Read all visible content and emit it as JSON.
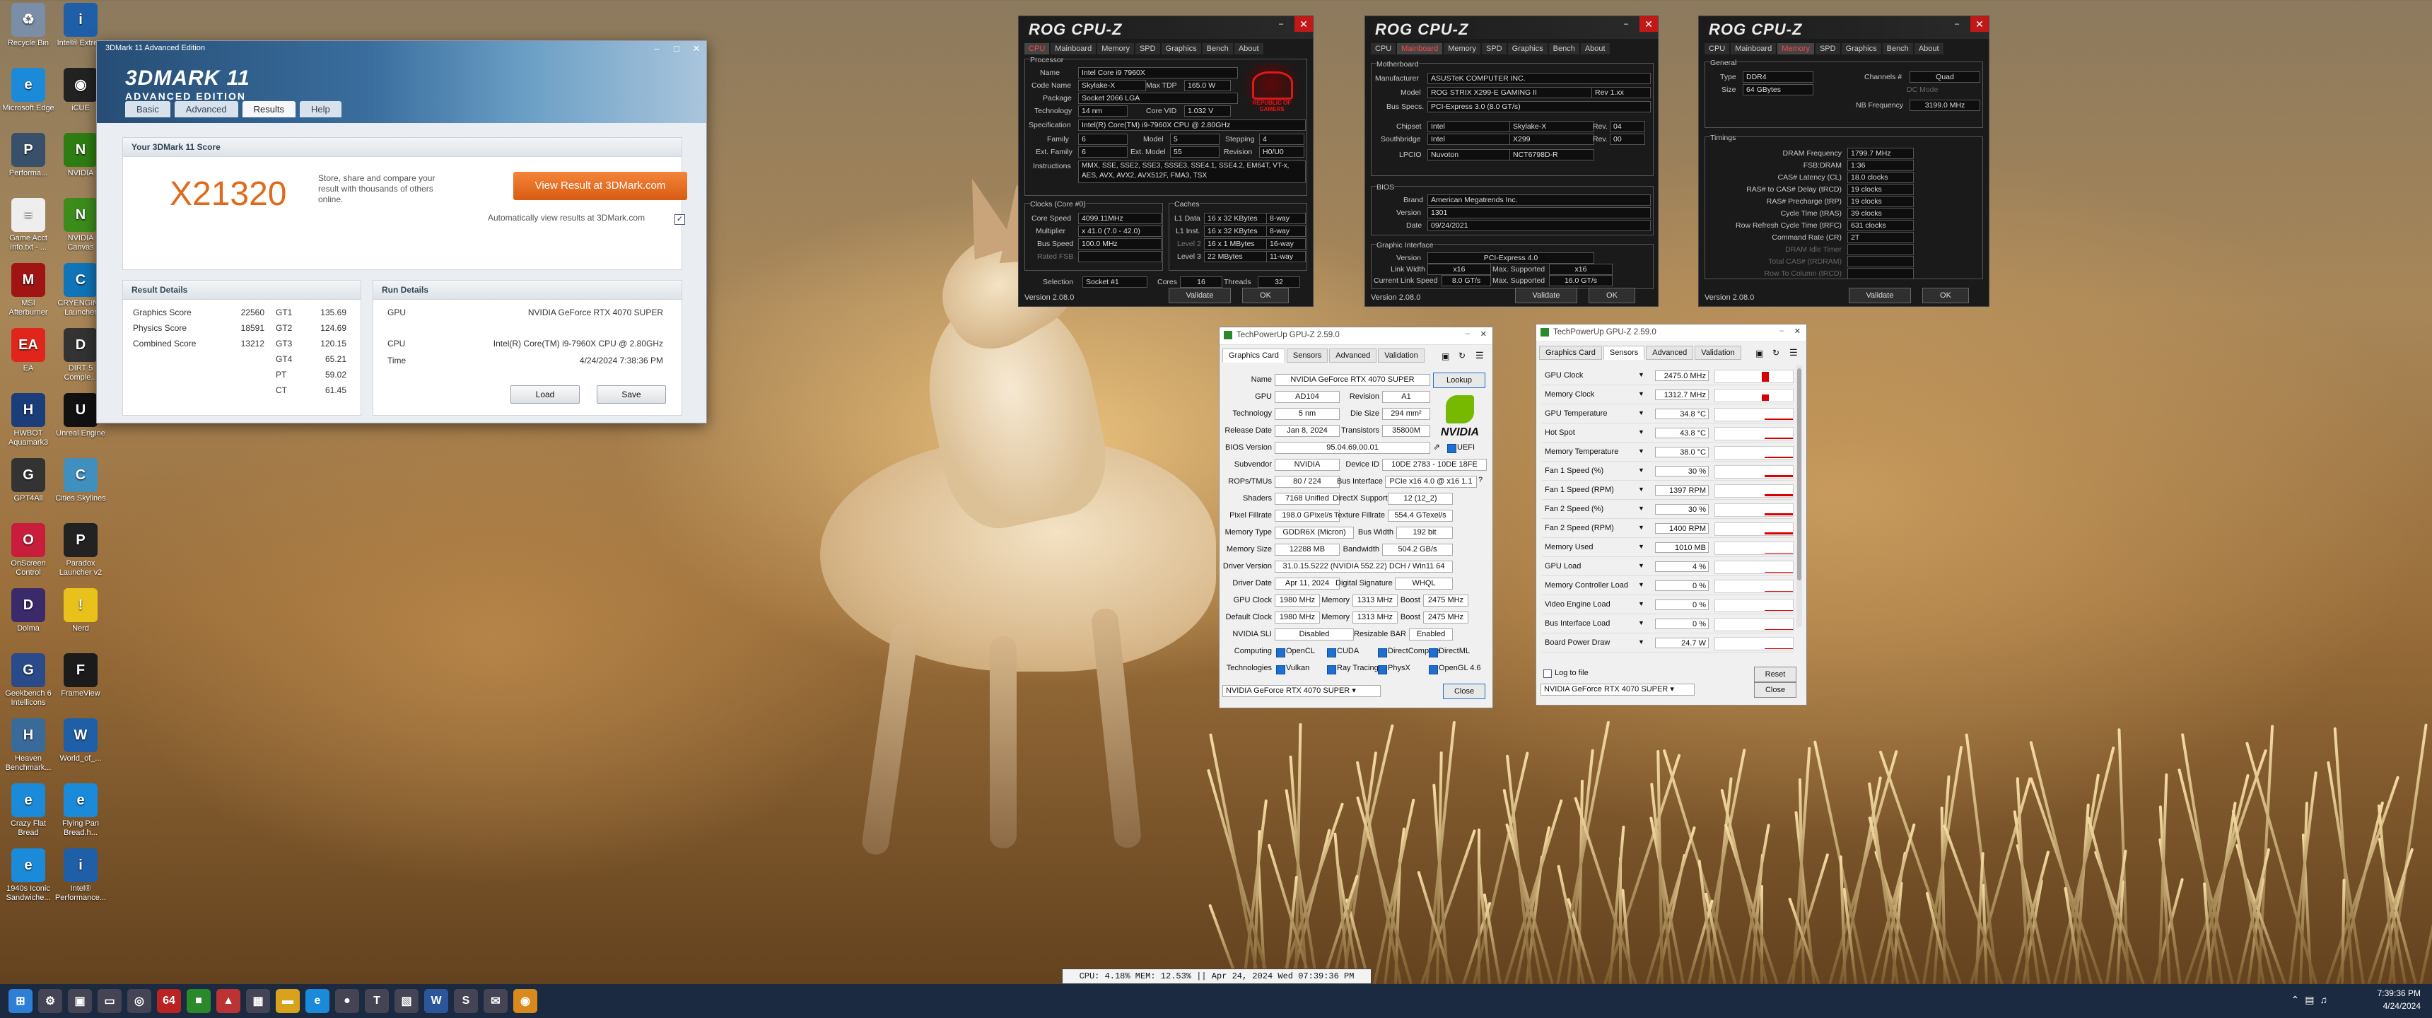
{
  "desktop": {
    "icons": [
      {
        "label": "Recycle Bin",
        "color": "#7a8ea8",
        "glyph": "♻"
      },
      {
        "label": "Intel® Extre...",
        "color": "#1f5fa8",
        "glyph": "i"
      },
      {
        "label": "Microsoft Edge",
        "color": "#1b8ad8",
        "glyph": "e"
      },
      {
        "label": "iCUE",
        "color": "#222",
        "glyph": "◉"
      },
      {
        "label": "Performa...",
        "color": "#38506a",
        "glyph": "P"
      },
      {
        "label": "NVIDIA",
        "color": "#2e7d12",
        "glyph": "N"
      },
      {
        "label": "Game Acct Info.txt - ...",
        "color": "#eee",
        "glyph": "≡"
      },
      {
        "label": "NVIDIA Canvas",
        "color": "#3c8c1c",
        "glyph": "N"
      },
      {
        "label": "MSI Afterburner",
        "color": "#a01414",
        "glyph": "M"
      },
      {
        "label": "CRYENGINE Launcher",
        "color": "#0f74b8",
        "glyph": "C"
      },
      {
        "label": "EA",
        "color": "#e0261c",
        "glyph": "EA"
      },
      {
        "label": "DIRT 5 Comple...",
        "color": "#333",
        "glyph": "D"
      },
      {
        "label": "HWBOT Aquamark3",
        "color": "#1b3e7a",
        "glyph": "H"
      },
      {
        "label": "Unreal Engine",
        "color": "#111",
        "glyph": "U"
      },
      {
        "label": "GPT4All",
        "color": "#333",
        "glyph": "G"
      },
      {
        "label": "Cities Skylines",
        "color": "#3f8fbf",
        "glyph": "C"
      },
      {
        "label": "OnScreen Control",
        "color": "#c81e3c",
        "glyph": "O"
      },
      {
        "label": "Paradox Launcher v2",
        "color": "#222",
        "glyph": "P"
      },
      {
        "label": "Dolma",
        "color": "#3a2a6a",
        "glyph": "D"
      },
      {
        "label": "Nerd",
        "color": "#e8c21a",
        "glyph": "!"
      },
      {
        "label": "Geekbench 6 Intellicons",
        "color": "#2a4a8a",
        "glyph": "G"
      },
      {
        "label": "FrameView",
        "color": "#1b1b1b",
        "glyph": "F"
      },
      {
        "label": "Heaven Benchmark...",
        "color": "#3a6a9a",
        "glyph": "H"
      },
      {
        "label": "World_of_...",
        "color": "#1f5fa8",
        "glyph": "W"
      },
      {
        "label": "Crazy Flat Bread",
        "color": "#1b8ad8",
        "glyph": "e"
      },
      {
        "label": "Flying Pan Bread.h...",
        "color": "#1b8ad8",
        "glyph": "e"
      },
      {
        "label": "1940s Iconic Sandwiche...",
        "color": "#1b8ad8",
        "glyph": "e"
      },
      {
        "label": "Intel® Performance...",
        "color": "#1f5fa8",
        "glyph": "i"
      }
    ]
  },
  "threedmark": {
    "title_main": "3DMARK 11",
    "title_sub": "ADVANCED EDITION",
    "window_title": "3DMark 11 Advanced Edition",
    "tabs": [
      "Basic",
      "Advanced",
      "Results",
      "Help"
    ],
    "score_header": "Your 3DMark 11 Score",
    "score": "X21320",
    "score_desc": "Store, share and compare your result with thousands of others online.",
    "view_button": "View Result at 3DMark.com",
    "auto_view": "Automatically view results at 3DMark.com",
    "result_details_title": "Result Details",
    "results": [
      {
        "name": "Graphics Score",
        "value": "22560",
        "test": "GT1",
        "tval": "135.69"
      },
      {
        "name": "Physics Score",
        "value": "18591",
        "test": "GT2",
        "tval": "124.69"
      },
      {
        "name": "Combined Score",
        "value": "13212",
        "test": "GT3",
        "tval": "120.15"
      },
      {
        "name": "",
        "value": "",
        "test": "GT4",
        "tval": "65.21"
      },
      {
        "name": "",
        "value": "",
        "test": "PT",
        "tval": "59.02"
      },
      {
        "name": "",
        "value": "",
        "test": "CT",
        "tval": "61.45"
      }
    ],
    "run_details_title": "Run Details",
    "gpu_label": "GPU",
    "gpu_value": "NVIDIA GeForce RTX 4070 SUPER",
    "cpu_label": "CPU",
    "cpu_value": "Intel(R) Core(TM) i9-7960X CPU @ 2.80GHz",
    "time_label": "Time",
    "time_value": "4/24/2024 7:38:36 PM",
    "load_button": "Load",
    "save_button": "Save"
  },
  "cpuz1": {
    "title": "ROG CPU-Z",
    "tabs": [
      "CPU",
      "Mainboard",
      "Memory",
      "SPD",
      "Graphics",
      "Bench",
      "About"
    ],
    "active_tab": "CPU",
    "processor_label": "Processor",
    "fields": {
      "name": "Intel Core i9 7960X",
      "code_name": "Skylake-X",
      "max_tdp": "165.0 W",
      "package": "Socket 2066 LGA",
      "technology": "14 nm",
      "core_vid": "1.032 V",
      "specification": "Intel(R) Core(TM) i9-7960X CPU @ 2.80GHz",
      "family": "6",
      "model": "5",
      "stepping": "4",
      "ext_family": "6",
      "ext_model": "55",
      "revision": "H0/U0",
      "instructions": "MMX, SSE, SSE2, SSE3, SSSE3, SSE4.1, SSE4.2, EM64T, VT-x, AES, AVX, AVX2, AVX512F, FMA3, TSX"
    },
    "clocks_label": "Clocks (Core #0)",
    "caches_label": "Caches",
    "core_speed": "4099.11MHz",
    "multiplier": "x 41.0 (7.0 - 42.0)",
    "bus_speed": "100.0 MHz",
    "rated_fsb": "Rated FSB",
    "l1d": "16 x 32 KBytes",
    "l1d_way": "8-way",
    "l1i": "16 x 32 KBytes",
    "l1i_way": "8-way",
    "l2": "16 x 1 MBytes",
    "l2_way": "16-way",
    "l3": "22 MBytes",
    "l3_way": "11-way",
    "selection": "Socket #1",
    "cores": "16",
    "threads": "32",
    "version": "Version 2.08.0",
    "validate": "Validate",
    "ok": "OK",
    "logo_text": "REPUBLIC OF GAMERS"
  },
  "cpuz2": {
    "title": "ROG CPU-Z",
    "active_tab": "Mainboard",
    "mb_label": "Motherboard",
    "manufacturer": "ASUSTeK COMPUTER INC.",
    "model": "ROG STRIX X299-E GAMING II",
    "model_rev": "Rev 1.xx",
    "bus_specs": "PCI-Express 3.0 (8.0 GT/s)",
    "chipset": "Intel",
    "chipset_name": "Skylake-X",
    "chipset_rev": "04",
    "southbridge": "Intel",
    "southbridge_name": "X299",
    "southbridge_rev": "00",
    "lpcio": "Nuvoton",
    "lpcio_name": "NCT6798D-R",
    "bios_label": "BIOS",
    "brand": "American Megatrends Inc.",
    "bios_version": "1301",
    "bios_date": "09/24/2021",
    "gi_label": "Graphic Interface",
    "gi_version": "PCI-Express 4.0",
    "link_width": "x16",
    "max_supported_w": "x16",
    "link_speed": "8.0 GT/s",
    "max_supported_s": "16.0 GT/s",
    "version": "Version 2.08.0",
    "validate": "Validate",
    "ok": "OK"
  },
  "cpuz3": {
    "title": "ROG CPU-Z",
    "active_tab": "Memory",
    "general_label": "General",
    "type": "DDR4",
    "channels": "Quad",
    "size": "64 GBytes",
    "dc_mode": "DC Mode",
    "nb_freq": "3199.0 MHz",
    "timings_label": "Timings",
    "timings": [
      {
        "name": "DRAM Frequency",
        "value": "1799.7 MHz"
      },
      {
        "name": "FSB:DRAM",
        "value": "1:36"
      },
      {
        "name": "CAS# Latency (CL)",
        "value": "18.0 clocks"
      },
      {
        "name": "RAS# to CAS# Delay (tRCD)",
        "value": "19 clocks"
      },
      {
        "name": "RAS# Precharge (tRP)",
        "value": "19 clocks"
      },
      {
        "name": "Cycle Time (tRAS)",
        "value": "39 clocks"
      },
      {
        "name": "Row Refresh Cycle Time (tRFC)",
        "value": "631 clocks"
      },
      {
        "name": "Command Rate (CR)",
        "value": "2T"
      },
      {
        "name": "DRAM Idle Timer",
        "value": ""
      },
      {
        "name": "Total CAS# (tRDRAM)",
        "value": ""
      },
      {
        "name": "Row To Column (tRCD)",
        "value": ""
      }
    ],
    "version": "Version 2.08.0",
    "validate": "Validate",
    "ok": "OK"
  },
  "gpuz1": {
    "title": "TechPowerUp GPU-Z 2.59.0",
    "tabs": [
      "Graphics Card",
      "Sensors",
      "Advanced",
      "Validation"
    ],
    "name": "NVIDIA GeForce RTX 4070 SUPER",
    "lookup": "Lookup",
    "gpu": "AD104",
    "revision": "A1",
    "technology": "5 nm",
    "die_size": "294 mm²",
    "release_date": "Jan 8, 2024",
    "transistors": "35800M",
    "bios_version": "95.04.69.00.01",
    "uefi": "UEFI",
    "subvendor": "NVIDIA",
    "device_id": "10DE 2783 - 10DE 18FE",
    "rops_tmus": "80 / 224",
    "bus_interface": "PCIe x16 4.0 @ x16 1.1",
    "shaders": "7168 Unified",
    "directx": "12 (12_2)",
    "pixel_fillrate": "198.0 GPixel/s",
    "texture_fillrate": "554.4 GTexel/s",
    "memory_type": "GDDR6X (Micron)",
    "bus_width": "192 bit",
    "memory_size": "12288 MB",
    "bandwidth": "504.2 GB/s",
    "driver_version": "31.0.15.5222 (NVIDIA 552.22) DCH / Win11 64",
    "driver_date": "Apr 11, 2024",
    "digital_signature": "WHQL",
    "gpu_clock": "1980 MHz",
    "memory_clock": "1313 MHz",
    "boost_clock": "2475 MHz",
    "def_gpu_clock": "1980 MHz",
    "def_memory_clock": "1313 MHz",
    "def_boost_clock": "2475 MHz",
    "sli": "Disabled",
    "resizable_bar": "Enabled",
    "computing": [
      "OpenCL",
      "CUDA",
      "DirectCompute",
      "DirectML"
    ],
    "technologies": [
      "Vulkan",
      "Ray Tracing",
      "PhysX",
      "OpenGL 4.6"
    ],
    "selected_card": "NVIDIA GeForce RTX 4070 SUPER",
    "close": "Close",
    "labels": {
      "name": "Name",
      "gpu": "GPU",
      "revision": "Revision",
      "technology": "Technology",
      "die_size": "Die Size",
      "release_date": "Release Date",
      "transistors": "Transistors",
      "bios_version": "BIOS Version",
      "subvendor": "Subvendor",
      "device_id": "Device ID",
      "rops": "ROPs/TMUs",
      "bus_interface": "Bus Interface",
      "shaders": "Shaders",
      "directx": "DirectX Support",
      "pixel": "Pixel Fillrate",
      "texture": "Texture Fillrate",
      "memtype": "Memory Type",
      "buswidth": "Bus Width",
      "memsize": "Memory Size",
      "bandwidth": "Bandwidth",
      "driver_version": "Driver Version",
      "driver_date": "Driver Date",
      "digsig": "Digital Signature",
      "gpu_clock": "GPU Clock",
      "memory": "Memory",
      "boost": "Boost",
      "default_clock": "Default Clock",
      "sli": "NVIDIA SLI",
      "rbar": "Resizable BAR",
      "computing": "Computing",
      "technologies": "Technologies"
    }
  },
  "gpuz2": {
    "title": "TechPowerUp GPU-Z 2.59.0",
    "tabs": [
      "Graphics Card",
      "Sensors",
      "Advanced",
      "Validation"
    ],
    "sensors": [
      {
        "name": "GPU Clock",
        "value": "2475.0 MHz",
        "level": 0.9
      },
      {
        "name": "Memory Clock",
        "value": "1312.7 MHz",
        "level": 0.6
      },
      {
        "name": "GPU Temperature",
        "value": "34.8 °C",
        "level": 0.1
      },
      {
        "name": "Hot Spot",
        "value": "43.8 °C",
        "level": 0.15
      },
      {
        "name": "Memory Temperature",
        "value": "38.0 °C",
        "level": 0.12
      },
      {
        "name": "Fan 1 Speed (%)",
        "value": "30 %",
        "level": 0.2
      },
      {
        "name": "Fan 1 Speed (RPM)",
        "value": "1397 RPM",
        "level": 0.2
      },
      {
        "name": "Fan 2 Speed (%)",
        "value": "30 %",
        "level": 0.2
      },
      {
        "name": "Fan 2 Speed (RPM)",
        "value": "1400 RPM",
        "level": 0.2
      },
      {
        "name": "Memory Used",
        "value": "1010 MB",
        "level": 0.06
      },
      {
        "name": "GPU Load",
        "value": "4 %",
        "level": 0.04
      },
      {
        "name": "Memory Controller Load",
        "value": "0 %",
        "level": 0.02
      },
      {
        "name": "Video Engine Load",
        "value": "0 %",
        "level": 0.0
      },
      {
        "name": "Bus Interface Load",
        "value": "0 %",
        "level": 0.0
      },
      {
        "name": "Board Power Draw",
        "value": "24.7 W",
        "level": 0.06
      }
    ],
    "log_to_file": "Log to file",
    "reset": "Reset",
    "selected_card": "NVIDIA GeForce RTX 4070 SUPER",
    "close": "Close"
  },
  "statusbar": "CPU: 4.18% MEM: 12.53% || Apr 24, 2024 Wed 07:39:36 PM",
  "taskbar": {
    "time": "7:39:36 PM",
    "date": "4/24/2024",
    "icons": [
      {
        "name": "start-icon",
        "glyph": "⊞",
        "color": "#2d7fd6"
      },
      {
        "name": "settings-icon",
        "glyph": "⚙",
        "color": "#445"
      },
      {
        "name": "taskview-icon",
        "glyph": "▣",
        "color": "#445"
      },
      {
        "name": "explorer-icon",
        "glyph": "▭",
        "color": "#445"
      },
      {
        "name": "steam-icon",
        "glyph": "◎",
        "color": "#445"
      },
      {
        "name": "cpuz-icon",
        "glyph": "64",
        "color": "#b22"
      },
      {
        "name": "gpuz-icon",
        "glyph": "■",
        "color": "#2a8a2a"
      },
      {
        "name": "3dmark-icon",
        "glyph": "▲",
        "color": "#b33"
      },
      {
        "name": "store-icon",
        "glyph": "▦",
        "color": "#445"
      },
      {
        "name": "folder-icon",
        "glyph": "▬",
        "color": "#d9a21c"
      },
      {
        "name": "edge-icon",
        "glyph": "e",
        "color": "#1b8ad8"
      },
      {
        "name": "chrome-icon",
        "glyph": "●",
        "color": "#445"
      },
      {
        "name": "teams-icon",
        "glyph": "T",
        "color": "#445"
      },
      {
        "name": "photos-icon",
        "glyph": "▧",
        "color": "#445"
      },
      {
        "name": "word-icon",
        "glyph": "W",
        "color": "#2b579a"
      },
      {
        "name": "steam2-icon",
        "glyph": "S",
        "color": "#445"
      },
      {
        "name": "mail-icon",
        "glyph": "✉",
        "color": "#445"
      },
      {
        "name": "game-icon",
        "glyph": "◉",
        "color": "#d88a1c"
      }
    ]
  }
}
